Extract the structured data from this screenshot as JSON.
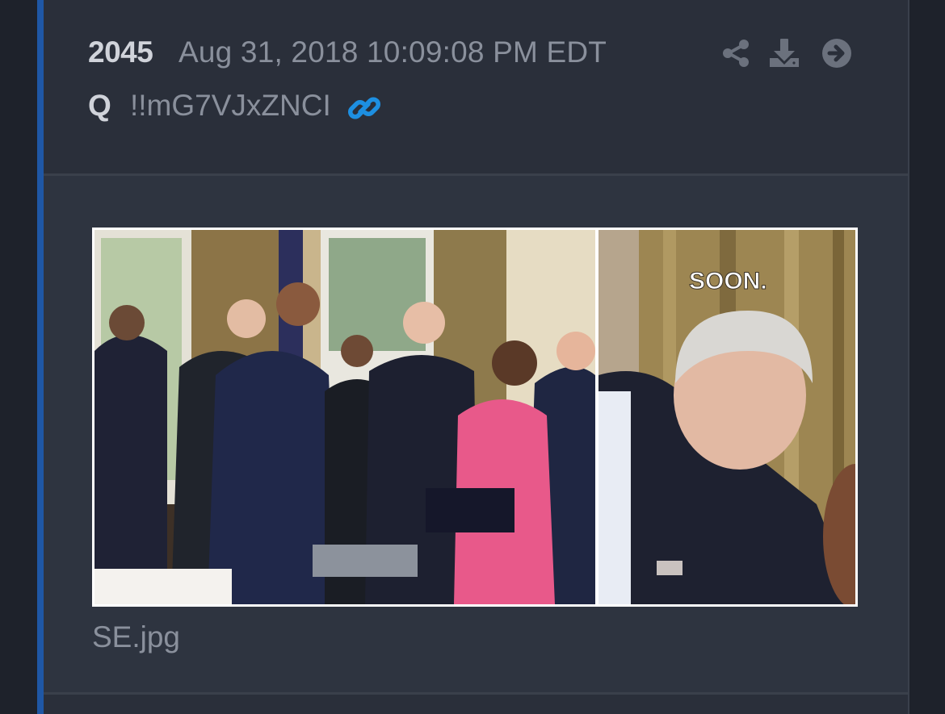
{
  "post": {
    "number": "2045",
    "timestamp": "Aug 31, 2018 10:09:08 PM EDT",
    "author": "Q",
    "tripcode": "!!mG7VJxZNCI"
  },
  "icons": {
    "link": "link-icon",
    "share": "share-icon",
    "download": "download-icon",
    "next": "arrow-circle-right-icon"
  },
  "attachment": {
    "filename": "SE.jpg",
    "overlay_text": "SOON."
  },
  "colors": {
    "accent": "#1f57a5",
    "link_icon": "#1d8fe1",
    "background": "#2a2f3a"
  }
}
